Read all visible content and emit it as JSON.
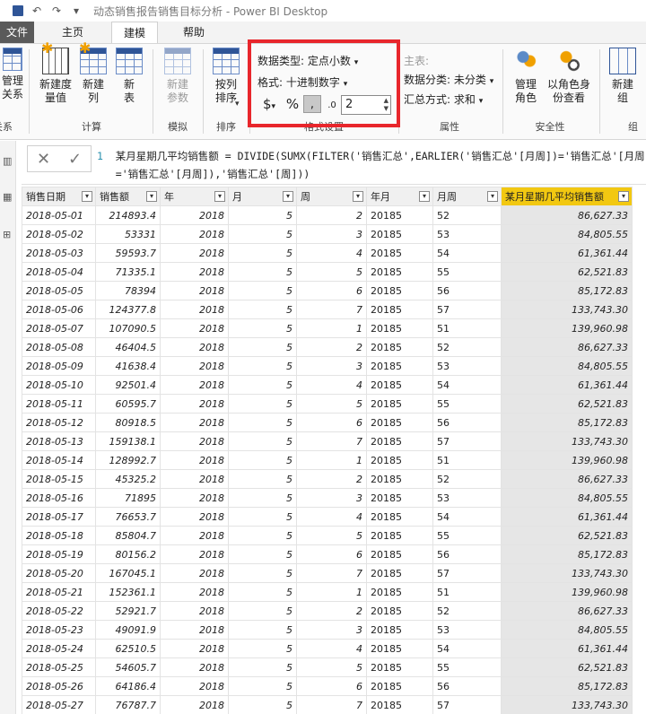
{
  "window": {
    "title": "动态销售报告销售目标分析 - Power BI Desktop"
  },
  "tabs": [
    {
      "id": "file",
      "label": "文件"
    },
    {
      "id": "home",
      "label": "主页"
    },
    {
      "id": "model",
      "label": "建模"
    },
    {
      "id": "help",
      "label": "帮助"
    }
  ],
  "ribbon": {
    "relations": {
      "button": "管理\n关系",
      "group": "关系"
    },
    "calc": {
      "group": "计算",
      "new_measure": "新建度\n量值",
      "new_column": "新建\n列",
      "new_table": "新\n表"
    },
    "whatif": {
      "group": "模拟",
      "new_param": "新建\n参数"
    },
    "sort": {
      "group": "排序",
      "sort_by": "按列\n排序"
    },
    "format": {
      "group": "格式设置",
      "data_type": "数据类型: 定点小数",
      "format": "格式: 十进制数字",
      "currency": "$",
      "percent": "%",
      "comma": ",",
      "decimals_icon": ".0",
      "decimals_value": "2"
    },
    "properties": {
      "group": "属性",
      "home_table": "主表:",
      "data_category": "数据分类: 未分类",
      "summarize": "汇总方式: 求和"
    },
    "security": {
      "group": "安全性",
      "manage_roles": "管理\n角色",
      "view_as": "以角色身\n份查看"
    },
    "groups": {
      "group": "组",
      "new_group": "新建\n组"
    }
  },
  "formula": {
    "line1": "某月星期几平均销售额 = DIVIDE(SUMX(FILTER('销售汇总',EARLIER('销售汇总'[月周])='销售汇总'[月周]",
    "line2": "='销售汇总'[月周]),'销售汇总'[周]))"
  },
  "table": {
    "columns": [
      "销售日期",
      "销售额",
      "年",
      "月",
      "周",
      "年月",
      "月周",
      "某月星期几平均销售额"
    ],
    "rows": [
      [
        "2018-05-01",
        "214893.4",
        "2018",
        "5",
        "2",
        "20185",
        "52",
        "86,627.33"
      ],
      [
        "2018-05-02",
        "53331",
        "2018",
        "5",
        "3",
        "20185",
        "53",
        "84,805.55"
      ],
      [
        "2018-05-03",
        "59593.7",
        "2018",
        "5",
        "4",
        "20185",
        "54",
        "61,361.44"
      ],
      [
        "2018-05-04",
        "71335.1",
        "2018",
        "5",
        "5",
        "20185",
        "55",
        "62,521.83"
      ],
      [
        "2018-05-05",
        "78394",
        "2018",
        "5",
        "6",
        "20185",
        "56",
        "85,172.83"
      ],
      [
        "2018-05-06",
        "124377.8",
        "2018",
        "5",
        "7",
        "20185",
        "57",
        "133,743.30"
      ],
      [
        "2018-05-07",
        "107090.5",
        "2018",
        "5",
        "1",
        "20185",
        "51",
        "139,960.98"
      ],
      [
        "2018-05-08",
        "46404.5",
        "2018",
        "5",
        "2",
        "20185",
        "52",
        "86,627.33"
      ],
      [
        "2018-05-09",
        "41638.4",
        "2018",
        "5",
        "3",
        "20185",
        "53",
        "84,805.55"
      ],
      [
        "2018-05-10",
        "92501.4",
        "2018",
        "5",
        "4",
        "20185",
        "54",
        "61,361.44"
      ],
      [
        "2018-05-11",
        "60595.7",
        "2018",
        "5",
        "5",
        "20185",
        "55",
        "62,521.83"
      ],
      [
        "2018-05-12",
        "80918.5",
        "2018",
        "5",
        "6",
        "20185",
        "56",
        "85,172.83"
      ],
      [
        "2018-05-13",
        "159138.1",
        "2018",
        "5",
        "7",
        "20185",
        "57",
        "133,743.30"
      ],
      [
        "2018-05-14",
        "128992.7",
        "2018",
        "5",
        "1",
        "20185",
        "51",
        "139,960.98"
      ],
      [
        "2018-05-15",
        "45325.2",
        "2018",
        "5",
        "2",
        "20185",
        "52",
        "86,627.33"
      ],
      [
        "2018-05-16",
        "71895",
        "2018",
        "5",
        "3",
        "20185",
        "53",
        "84,805.55"
      ],
      [
        "2018-05-17",
        "76653.7",
        "2018",
        "5",
        "4",
        "20185",
        "54",
        "61,361.44"
      ],
      [
        "2018-05-18",
        "85804.7",
        "2018",
        "5",
        "5",
        "20185",
        "55",
        "62,521.83"
      ],
      [
        "2018-05-19",
        "80156.2",
        "2018",
        "5",
        "6",
        "20185",
        "56",
        "85,172.83"
      ],
      [
        "2018-05-20",
        "167045.1",
        "2018",
        "5",
        "7",
        "20185",
        "57",
        "133,743.30"
      ],
      [
        "2018-05-21",
        "152361.1",
        "2018",
        "5",
        "1",
        "20185",
        "51",
        "139,960.98"
      ],
      [
        "2018-05-22",
        "52921.7",
        "2018",
        "5",
        "2",
        "20185",
        "52",
        "86,627.33"
      ],
      [
        "2018-05-23",
        "49091.9",
        "2018",
        "5",
        "3",
        "20185",
        "53",
        "84,805.55"
      ],
      [
        "2018-05-24",
        "62510.5",
        "2018",
        "5",
        "4",
        "20185",
        "54",
        "61,361.44"
      ],
      [
        "2018-05-25",
        "54605.7",
        "2018",
        "5",
        "5",
        "20185",
        "55",
        "62,521.83"
      ],
      [
        "2018-05-26",
        "64186.4",
        "2018",
        "5",
        "6",
        "20185",
        "56",
        "85,172.83"
      ],
      [
        "2018-05-27",
        "76787.7",
        "2018",
        "5",
        "7",
        "20185",
        "57",
        "133,743.30"
      ]
    ]
  }
}
